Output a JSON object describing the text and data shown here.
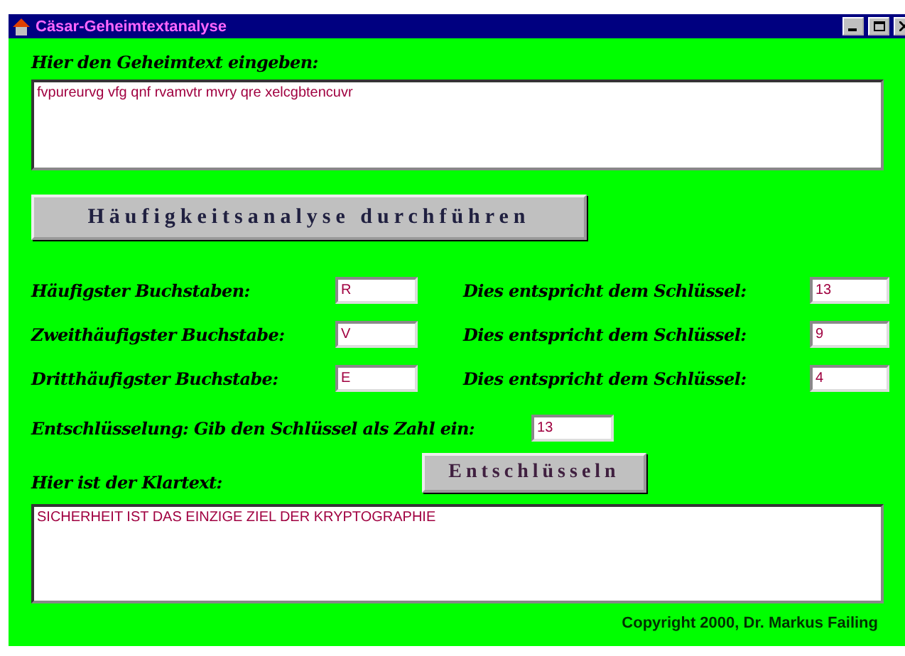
{
  "window": {
    "title": "Cäsar-Geheimtextanalyse"
  },
  "ciphertext": {
    "label": "Hier den Geheimtext eingeben:",
    "value": "fvpureurvg vfg qnf rvamvtr mvry qre xelcgbtencuvr"
  },
  "analyze_button": "Häufigkeitsanalyse durchführen",
  "frequency_rows": [
    {
      "label": "Häufigster Buchstaben:",
      "letter": "R",
      "key_label": "Dies entspricht dem Schlüssel:",
      "key": "13"
    },
    {
      "label": "Zweithäufigster Buchstabe:",
      "letter": "V",
      "key_label": "Dies entspricht dem Schlüssel:",
      "key": "9"
    },
    {
      "label": "Dritthäufigster Buchstabe:",
      "letter": "E",
      "key_label": "Dies entspricht dem Schlüssel:",
      "key": "4"
    }
  ],
  "decryption": {
    "label": "Entschlüsselung: Gib den Schlüssel als Zahl ein:",
    "key": "13",
    "button": "Entschlüsseln"
  },
  "plaintext": {
    "label": "Hier ist der Klartext:",
    "value": "SICHERHEIT IST DAS EINZIGE ZIEL DER KRYPTOGRAPHIE"
  },
  "copyright": "Copyright 2000, Dr. Markus Failing"
}
